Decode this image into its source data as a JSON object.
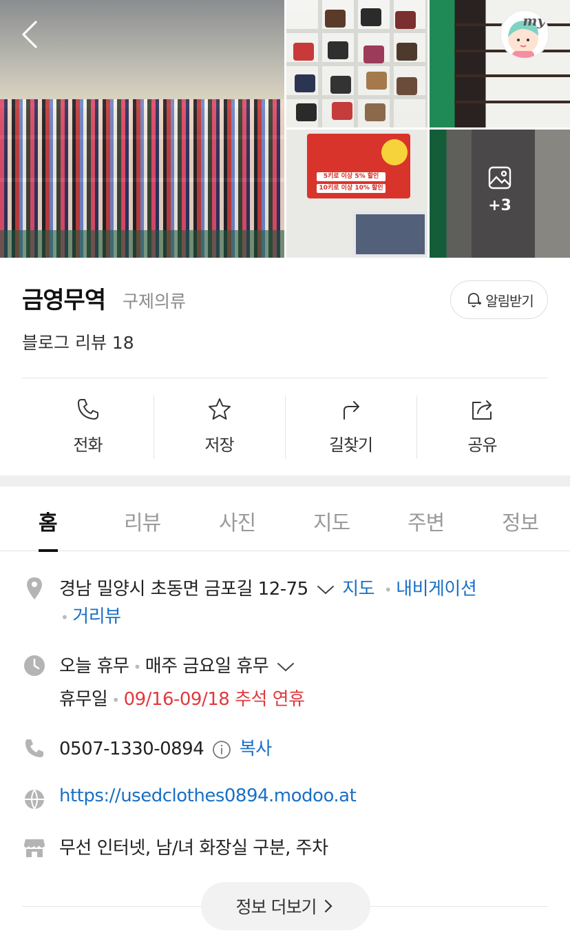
{
  "gallery": {
    "more_count": "+3",
    "avatar_label": "my",
    "sign_lines": [
      "5키로 이상 5% 할인",
      "10키로 이상 10% 할인"
    ]
  },
  "place": {
    "name": "금영무역",
    "category": "구제의류",
    "review_text": "블로그 리뷰 18",
    "notify_label": "알림받기"
  },
  "actions": [
    {
      "label": "전화",
      "icon": "phone-icon"
    },
    {
      "label": "저장",
      "icon": "star-icon"
    },
    {
      "label": "길찾기",
      "icon": "directions-icon"
    },
    {
      "label": "공유",
      "icon": "share-icon"
    }
  ],
  "tabs": [
    {
      "label": "홈",
      "active": true
    },
    {
      "label": "리뷰",
      "active": false
    },
    {
      "label": "사진",
      "active": false
    },
    {
      "label": "지도",
      "active": false
    },
    {
      "label": "주변",
      "active": false
    },
    {
      "label": "정보",
      "active": false
    }
  ],
  "details": {
    "address": "경남 밀양시 초동면 금포길 12-75",
    "map_link": "지도",
    "navigation_link": "내비게이션",
    "street_view_link": "거리뷰",
    "today_status": "오늘 휴무",
    "weekly_closed": "매주 금요일 휴무",
    "holiday_label": "휴무일",
    "holiday_value": "09/16-09/18 추석 연휴",
    "phone": "0507-1330-0894",
    "copy_label": "복사",
    "website": "https://usedclothes0894.modoo.at",
    "amenities": "무선 인터넷, 남/녀 화장실 구분, 주차"
  },
  "more_info_label": "정보 더보기",
  "colors": {
    "link_blue": "#1a6fc4",
    "holiday_red": "#e0393e",
    "icon_gray": "#b4b4b4"
  }
}
